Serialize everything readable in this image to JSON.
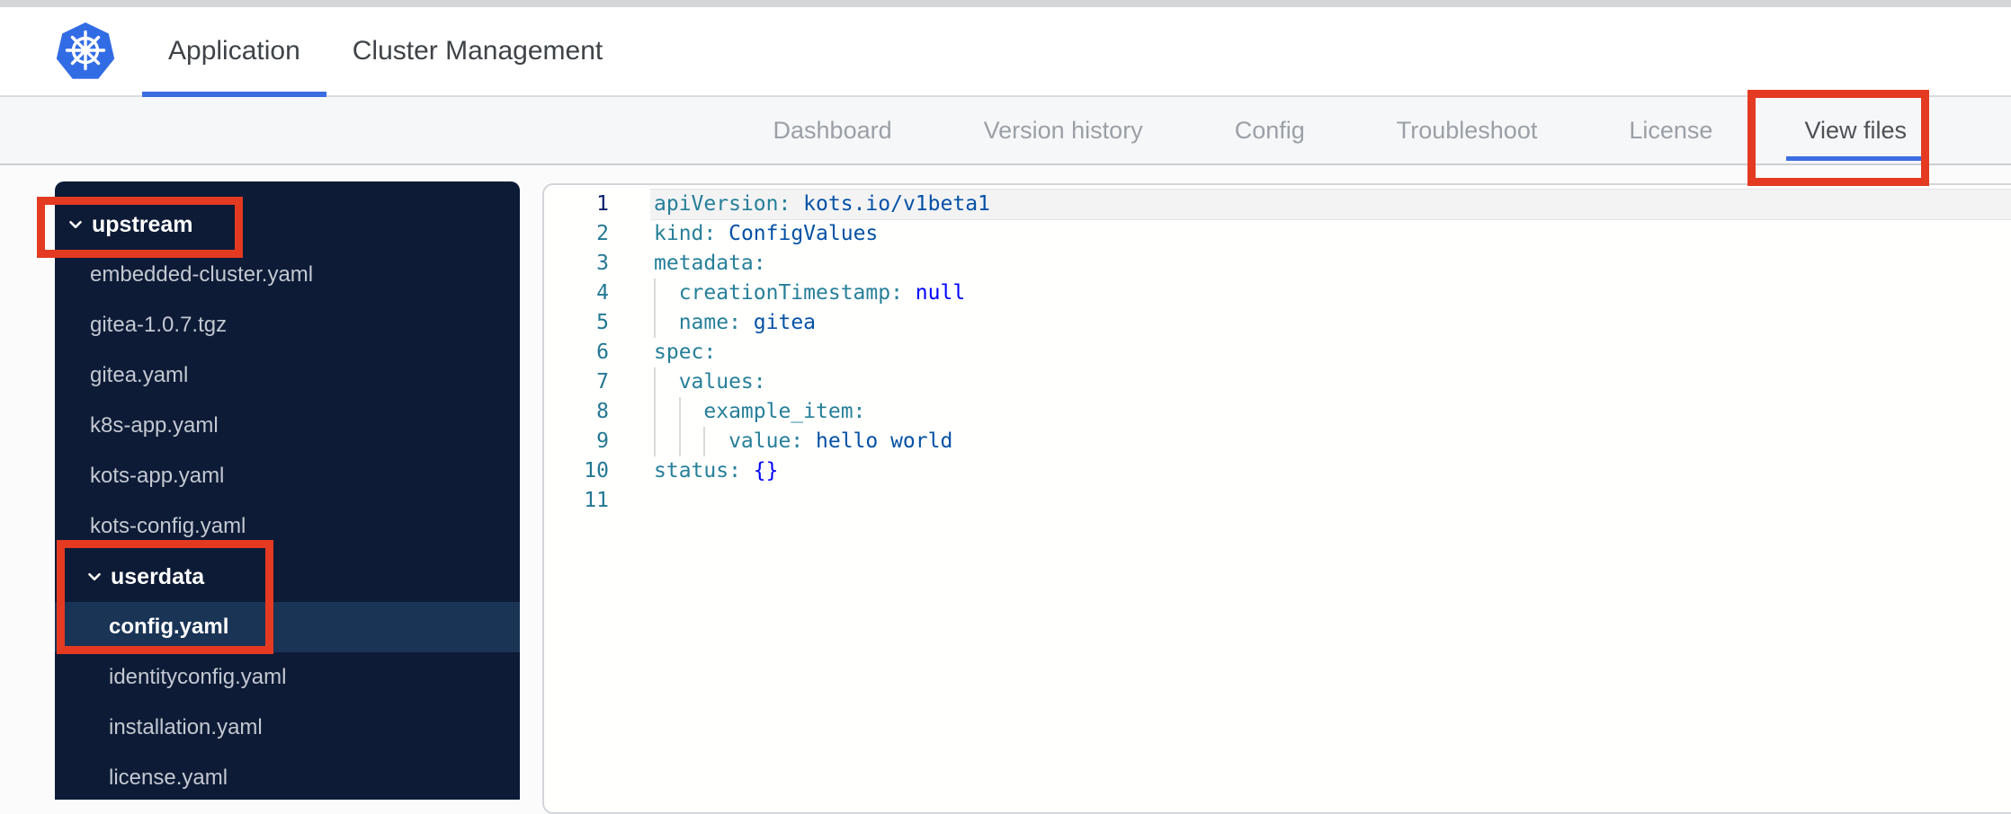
{
  "colors": {
    "accent_blue": "#3b6ce1",
    "kubernetes_blue": "#326ce5",
    "annotation_red": "#e43a22",
    "sidebar_bg": "#0d1b36",
    "sidebar_selected_bg": "#1a3456",
    "navbar_bg": "#f6f7f8",
    "syntax_key": "#267f99",
    "syntax_string": "#0451a5",
    "syntax_keyword": "#0000ff",
    "line_number": "#237893",
    "line_number_active": "#0b216f"
  },
  "topbar": {
    "logo": "kubernetes-logo",
    "tabs": [
      {
        "label": "Application",
        "active": true
      },
      {
        "label": "Cluster Management",
        "active": false
      }
    ]
  },
  "nav": {
    "tabs": [
      {
        "label": "Dashboard",
        "active": false
      },
      {
        "label": "Version history",
        "active": false
      },
      {
        "label": "Config",
        "active": false
      },
      {
        "label": "Troubleshoot",
        "active": false
      },
      {
        "label": "License",
        "active": false
      },
      {
        "label": "View files",
        "active": true
      }
    ]
  },
  "sidebar": {
    "items": [
      {
        "type": "folder",
        "name": "upstream",
        "level": 1,
        "expanded": true,
        "selected": false
      },
      {
        "type": "file",
        "name": "embedded-cluster.yaml",
        "level": 1,
        "selected": false
      },
      {
        "type": "file",
        "name": "gitea-1.0.7.tgz",
        "level": 1,
        "selected": false
      },
      {
        "type": "file",
        "name": "gitea.yaml",
        "level": 1,
        "selected": false
      },
      {
        "type": "file",
        "name": "k8s-app.yaml",
        "level": 1,
        "selected": false
      },
      {
        "type": "file",
        "name": "kots-app.yaml",
        "level": 1,
        "selected": false
      },
      {
        "type": "file",
        "name": "kots-config.yaml",
        "level": 1,
        "selected": false
      },
      {
        "type": "folder",
        "name": "userdata",
        "level": 2,
        "expanded": true,
        "selected": false
      },
      {
        "type": "file",
        "name": "config.yaml",
        "level": 2,
        "selected": true
      },
      {
        "type": "file",
        "name": "identityconfig.yaml",
        "level": 2,
        "selected": false
      },
      {
        "type": "file",
        "name": "installation.yaml",
        "level": 2,
        "selected": false
      },
      {
        "type": "file",
        "name": "license.yaml",
        "level": 2,
        "selected": false
      }
    ]
  },
  "editor": {
    "language": "yaml",
    "lines": [
      {
        "num": "1",
        "active": true,
        "guides": 0,
        "key": "apiVersion:",
        "value": " kots.io/v1beta1",
        "value_type": "string"
      },
      {
        "num": "2",
        "active": false,
        "guides": 0,
        "key": "kind:",
        "value": " ConfigValues",
        "value_type": "string"
      },
      {
        "num": "3",
        "active": false,
        "guides": 0,
        "key": "metadata:",
        "value": "",
        "value_type": "none"
      },
      {
        "num": "4",
        "active": false,
        "guides": 1,
        "key": "creationTimestamp:",
        "value": " null",
        "value_type": "keyword"
      },
      {
        "num": "5",
        "active": false,
        "guides": 1,
        "key": "name:",
        "value": " gitea",
        "value_type": "string"
      },
      {
        "num": "6",
        "active": false,
        "guides": 0,
        "key": "spec:",
        "value": "",
        "value_type": "none"
      },
      {
        "num": "7",
        "active": false,
        "guides": 1,
        "key": "values:",
        "value": "",
        "value_type": "none"
      },
      {
        "num": "8",
        "active": false,
        "guides": 2,
        "key": "example_item:",
        "value": "",
        "value_type": "none"
      },
      {
        "num": "9",
        "active": false,
        "guides": 3,
        "key": "value:",
        "value": " hello world",
        "value_type": "string"
      },
      {
        "num": "10",
        "active": false,
        "guides": 0,
        "key": "status:",
        "value": " {}",
        "value_type": "keyword"
      },
      {
        "num": "11",
        "active": false,
        "guides": 0,
        "key": "",
        "value": "",
        "value_type": "none"
      }
    ]
  },
  "annotations": {
    "color": "#e43a22",
    "boxes": [
      {
        "target": "view-files-tab"
      },
      {
        "target": "upstream-folder"
      },
      {
        "target": "userdata-folder-and-config-yaml"
      }
    ]
  }
}
